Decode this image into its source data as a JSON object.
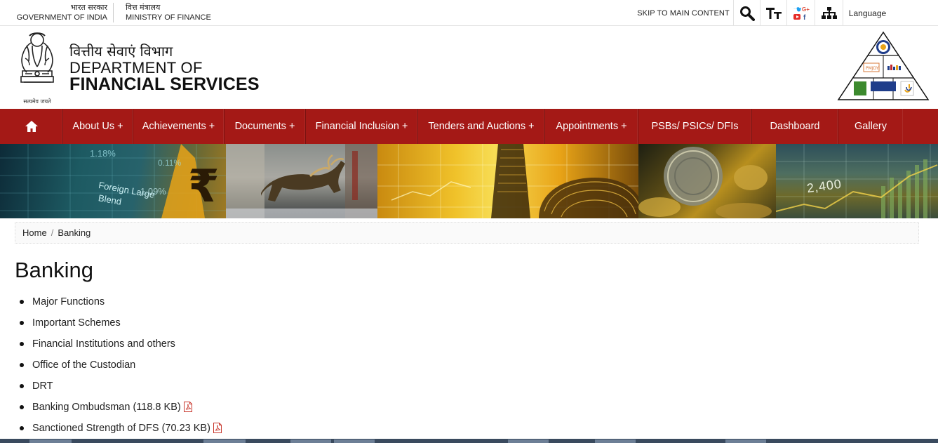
{
  "topbar": {
    "gov_hi": "भारत सरकार",
    "gov_en": "GOVERNMENT OF INDIA",
    "ministry_hi": "वित्त मंत्रालय",
    "ministry_en": "MINISTRY OF FINANCE",
    "skip": "SKIP TO MAIN CONTENT",
    "language": "Language"
  },
  "header": {
    "motto": "सत्यमेव जयते",
    "dept_hi": "वित्तीय सेवाएं विभाग",
    "dept_line1": "DEPARTMENT OF",
    "dept_line2": "FINANCIAL SERVICES"
  },
  "nav": {
    "home_icon": "home-icon",
    "items": [
      {
        "label": "About Us +"
      },
      {
        "label": "Achievements +"
      },
      {
        "label": "Documents +"
      },
      {
        "label": "Financial Inclusion +"
      },
      {
        "label": "Tenders and Auctions +"
      },
      {
        "label": "Appointments +"
      },
      {
        "label": "PSBs/ PSICs/ DFIs"
      },
      {
        "label": "Dashboard"
      },
      {
        "label": "Gallery"
      }
    ]
  },
  "banner": {
    "text_1": "Foreign Large",
    "text_2": "Blend",
    "value_1": "1.18%",
    "value_2": "0.11%",
    "value_3": "1.09%",
    "value_4": "2,400"
  },
  "breadcrumb": {
    "home": "Home",
    "separator": "/",
    "current": "Banking"
  },
  "main": {
    "title": "Banking",
    "items": [
      {
        "label": "Major Functions",
        "pdf": false
      },
      {
        "label": "Important Schemes",
        "pdf": false
      },
      {
        "label": "Financial Institutions and others",
        "pdf": false
      },
      {
        "label": "Office of the Custodian",
        "pdf": false
      },
      {
        "label": "DRT",
        "pdf": false
      },
      {
        "label": "Banking Ombudsman (118.8 KB)",
        "pdf": true
      },
      {
        "label": "Sanctioned Strength of DFS (70.23 KB)",
        "pdf": true
      }
    ]
  },
  "colors": {
    "nav_bg": "#a41916",
    "accent_gold": "#e8a317"
  }
}
